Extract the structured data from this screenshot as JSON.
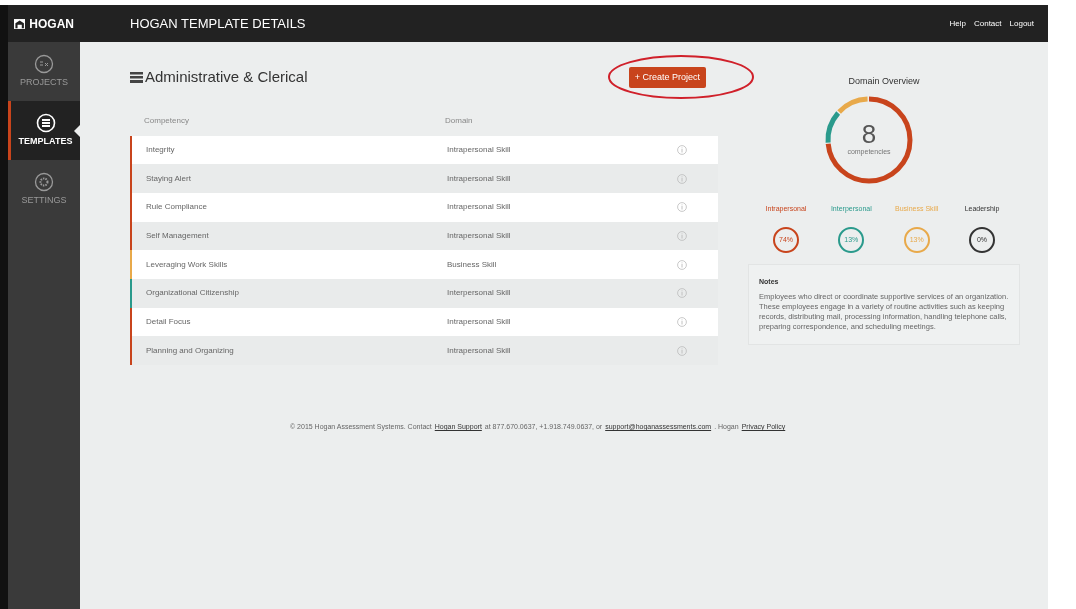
{
  "sidebar": {
    "logo": "HOGAN",
    "items": [
      {
        "label": "PROJECTS",
        "selected": false
      },
      {
        "label": "TEMPLATES",
        "selected": true
      },
      {
        "label": "SETTINGS",
        "selected": false
      }
    ]
  },
  "header": {
    "title": "HOGAN TEMPLATE DETAILS",
    "links": [
      "Help",
      "Contact",
      "Logout"
    ]
  },
  "page_title": "Administrative & Clerical",
  "create_button": "+ Create Project",
  "table": {
    "columns": [
      "Competency",
      "Domain"
    ],
    "rows": [
      {
        "competency": "Integrity",
        "domain": "Intrapersonal Skill",
        "color": "#c8441c"
      },
      {
        "competency": "Staying Alert",
        "domain": "Intrapersonal Skill",
        "color": "#c8441c"
      },
      {
        "competency": "Rule Compliance",
        "domain": "Intrapersonal Skill",
        "color": "#c8441c"
      },
      {
        "competency": "Self Management",
        "domain": "Intrapersonal Skill",
        "color": "#c8441c"
      },
      {
        "competency": "Leveraging Work Skills",
        "domain": "Business Skill",
        "color": "#e8a94a"
      },
      {
        "competency": "Organizational Citizenship",
        "domain": "Interpersonal Skill",
        "color": "#2a9a8c"
      },
      {
        "competency": "Detail Focus",
        "domain": "Intrapersonal Skill",
        "color": "#c8441c"
      },
      {
        "competency": "Planning and Organizing",
        "domain": "Intrapersonal Skill",
        "color": "#c8441c"
      }
    ]
  },
  "overview": {
    "title": "Domain Overview",
    "count": "8",
    "count_label": "competencies",
    "domains": [
      {
        "label": "Intrapersonal",
        "percent": "74%",
        "color": "#c8441c"
      },
      {
        "label": "Interpersonal",
        "percent": "13%",
        "color": "#2a9a8c"
      },
      {
        "label": "Business Skill",
        "percent": "13%",
        "color": "#e8a94a"
      },
      {
        "label": "Leadership",
        "percent": "0%",
        "color": "#333333"
      }
    ]
  },
  "notes": {
    "title": "Notes",
    "text": "Employees who direct or coordinate supportive services of an organization. These employees engage in a variety of routine activities such as keeping records, distributing mail, processing information, handling telephone calls, preparing correspondence, and scheduling meetings."
  },
  "footer": {
    "parts": [
      {
        "kind": "text",
        "text": "© 2015 Hogan Assessment Systems. Contact"
      },
      {
        "kind": "link",
        "text": "Hogan Support"
      },
      {
        "kind": "text",
        "text": "at 877.670.0637, +1.918.749.0637, or"
      },
      {
        "kind": "link",
        "text": "support@hoganassessments.com"
      },
      {
        "kind": "text",
        "text": ". Hogan"
      },
      {
        "kind": "link",
        "text": "Privacy Policy"
      }
    ]
  }
}
